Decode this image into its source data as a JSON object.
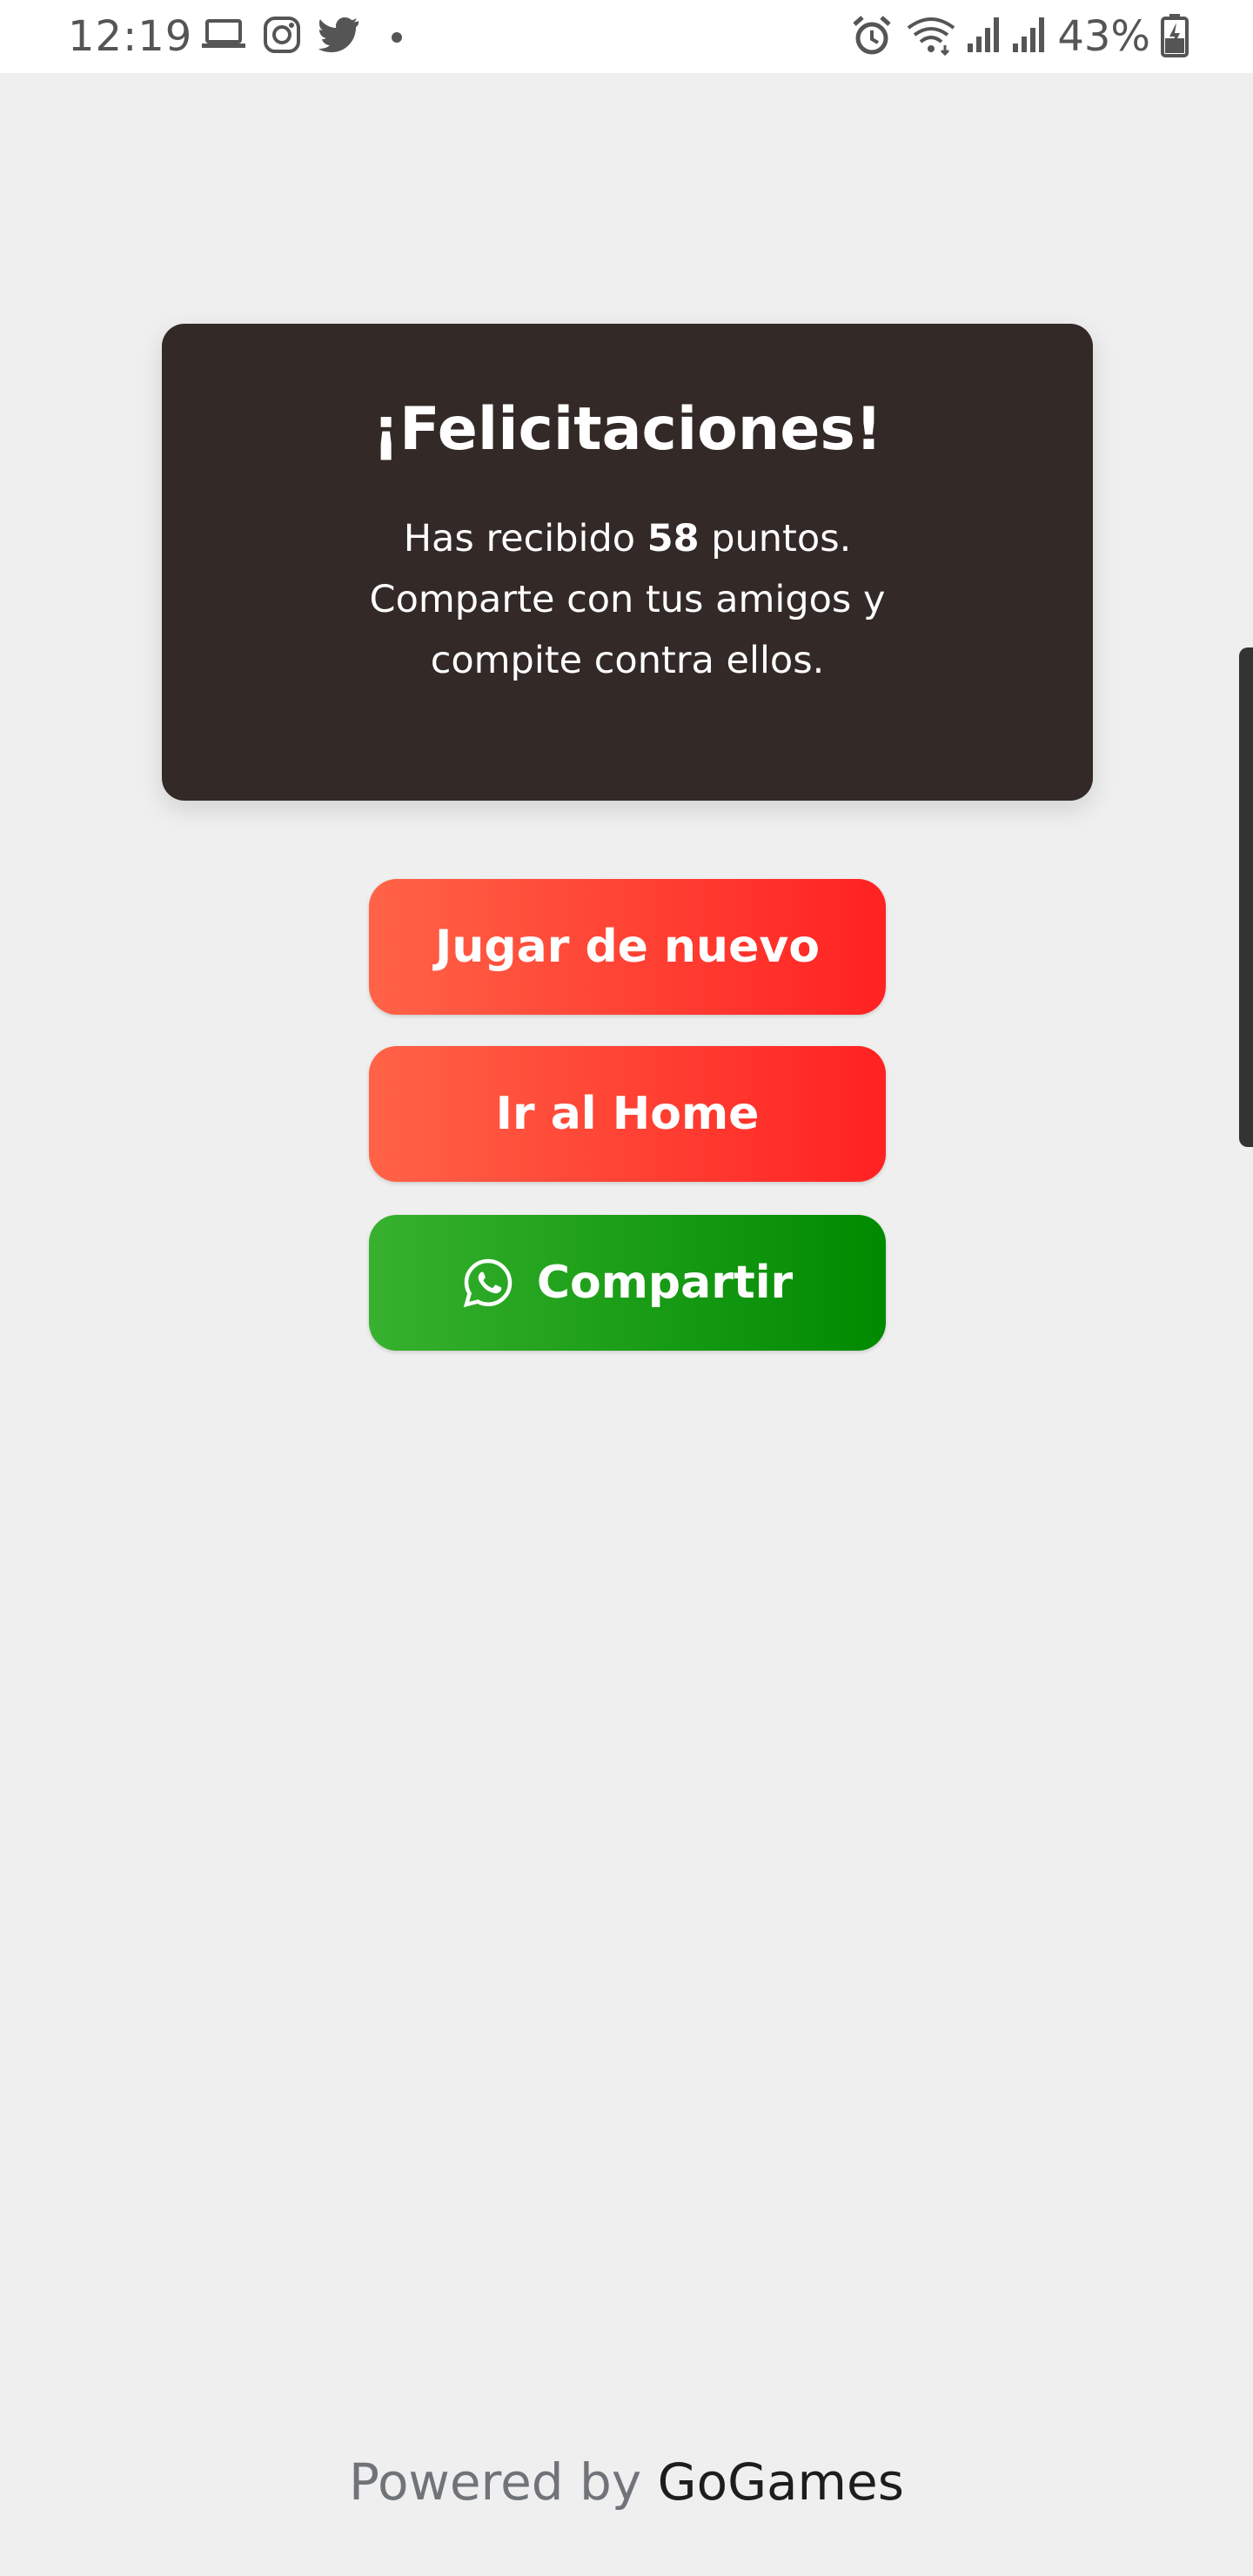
{
  "status_bar": {
    "time": "12:19",
    "battery": "43%",
    "left_icons": [
      "laptop-icon",
      "instagram-icon",
      "twitter-icon",
      "dot-icon"
    ],
    "right_icons": [
      "alarm-icon",
      "wifi-icon",
      "signal-icon",
      "signal-icon",
      "battery-icon"
    ]
  },
  "card": {
    "title": "¡Felicitaciones!",
    "line1_prefix": "Has recibido ",
    "points": "58",
    "line1_suffix": " puntos.",
    "line2": "Comparte con tus amigos y",
    "line3": "compite contra ellos."
  },
  "buttons": {
    "play_again": "Jugar de nuevo",
    "home": "Ir al Home",
    "share": "Compartir"
  },
  "footer": {
    "powered": "Powered by",
    "brand": "GoGames"
  },
  "colors": {
    "background": "#efefef",
    "card": "#332927",
    "red_start": "#ff6347",
    "red_end": "#ff2222",
    "green_start": "#37b12f",
    "green_end": "#008a00"
  }
}
